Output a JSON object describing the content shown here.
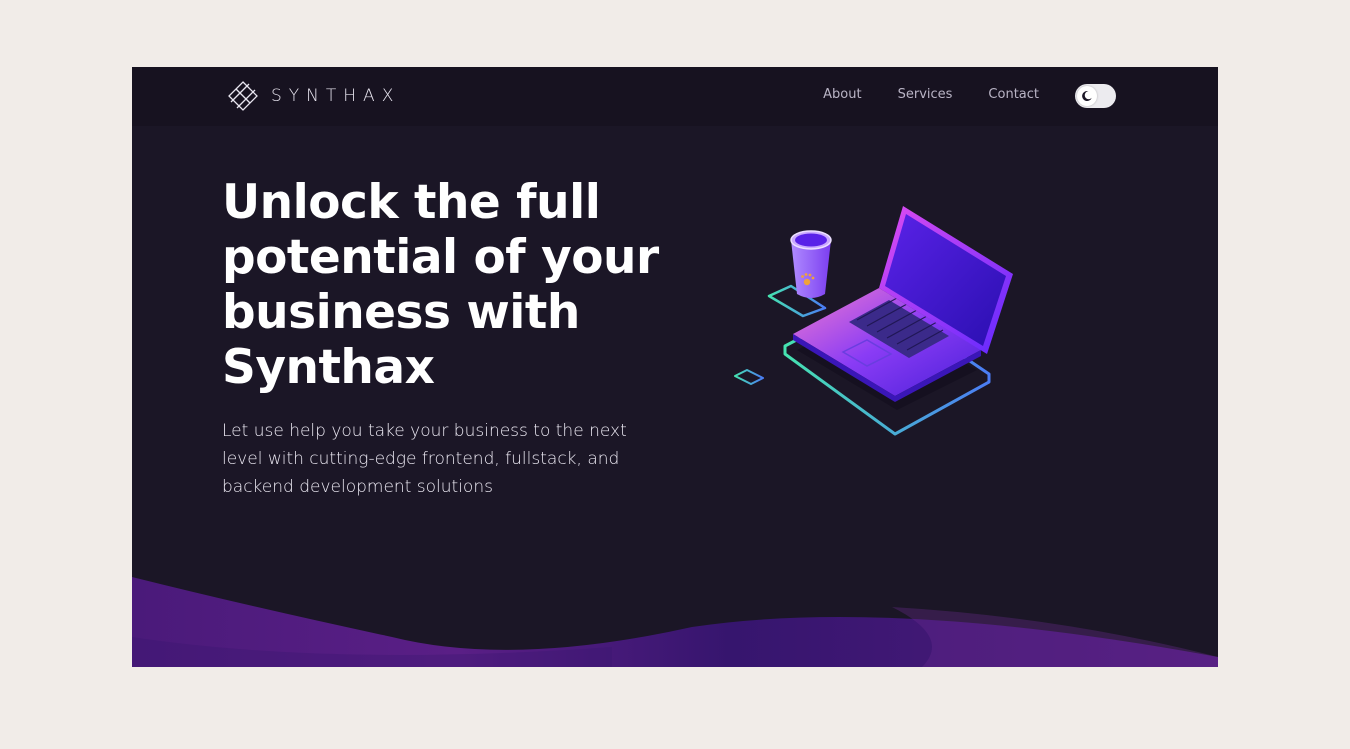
{
  "header": {
    "brand": "SYNTHAX",
    "nav": [
      {
        "label": "About"
      },
      {
        "label": "Services"
      },
      {
        "label": "Contact"
      }
    ],
    "theme_toggle": {
      "icon": "moon-icon",
      "state": "dark"
    }
  },
  "hero": {
    "title": "Unlock the full potential of your business with Synthax",
    "subtitle": "Let use help you take your business to the next level with cutting-edge frontend, fullstack, and backend development solutions",
    "illustration": "laptop-and-cup-illustration"
  },
  "colors": {
    "page_bg": "#f1ece8",
    "hero_bg": "#1b1626",
    "topbar_bg": "#171220",
    "accent_purple": "#7b2cf0",
    "accent_teal": "#3de0b0",
    "wave": "#3a1670"
  }
}
